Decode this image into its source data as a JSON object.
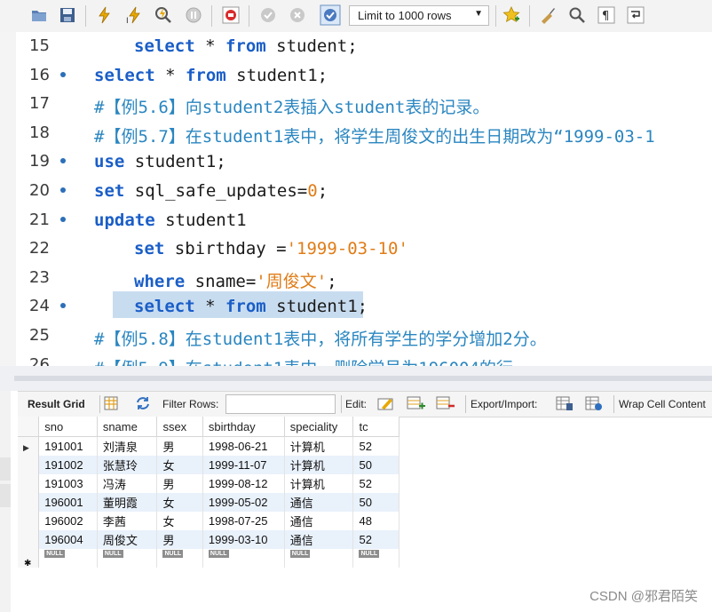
{
  "toolbar": {
    "limit_label": "Limit to 1000 rows",
    "icons": [
      "open-folder-icon",
      "save-icon",
      "execute-icon",
      "execute-current-icon",
      "explain-icon",
      "stop-icon",
      "toggle-error-icon",
      "commit-icon",
      "rollback-icon",
      "autocommit-icon",
      "beautify-icon",
      "find-icon",
      "invisible-chars-icon",
      "wrap-icon"
    ]
  },
  "editor": {
    "lines": [
      {
        "num": "15",
        "dot": false,
        "indent": "    ",
        "tokens": [
          [
            "kw",
            "select"
          ],
          [
            "tx",
            " * "
          ],
          [
            "kw",
            "from"
          ],
          [
            "tx",
            " student;"
          ]
        ]
      },
      {
        "num": "16",
        "dot": true,
        "indent": "",
        "tokens": [
          [
            "kw",
            "select"
          ],
          [
            "tx",
            " * "
          ],
          [
            "kw",
            "from"
          ],
          [
            "tx",
            " student1;"
          ]
        ]
      },
      {
        "num": "17",
        "dot": false,
        "indent": "",
        "tokens": [
          [
            "cm",
            "#【例5.6】向student2表插入student表的记录。"
          ]
        ]
      },
      {
        "num": "18",
        "dot": false,
        "indent": "",
        "tokens": [
          [
            "cm",
            "#【例5.7】在student1表中，将学生周俊文的出生日期改为“1999-03-1"
          ]
        ]
      },
      {
        "num": "19",
        "dot": true,
        "indent": "",
        "tokens": [
          [
            "kw",
            "use"
          ],
          [
            "tx",
            " student1;"
          ]
        ]
      },
      {
        "num": "20",
        "dot": true,
        "indent": "",
        "tokens": [
          [
            "kw",
            "set"
          ],
          [
            "tx",
            " sql_safe_updates="
          ],
          [
            "nm",
            "0"
          ],
          [
            "tx",
            ";"
          ]
        ]
      },
      {
        "num": "21",
        "dot": true,
        "indent": "",
        "tokens": [
          [
            "kw",
            "update"
          ],
          [
            "tx",
            " student1"
          ]
        ]
      },
      {
        "num": "22",
        "dot": false,
        "indent": "    ",
        "tokens": [
          [
            "kw",
            "set"
          ],
          [
            "tx",
            " sbirthday ="
          ],
          [
            "st",
            "'1999-03-10'"
          ]
        ]
      },
      {
        "num": "23",
        "dot": false,
        "indent": "    ",
        "tokens": [
          [
            "kw",
            "where"
          ],
          [
            "tx",
            " sname="
          ],
          [
            "st",
            "'周俊文'"
          ],
          [
            "tx",
            ";"
          ]
        ]
      },
      {
        "num": "24",
        "dot": true,
        "indent": "    ",
        "tokens": [
          [
            "kw",
            "select"
          ],
          [
            "tx",
            " * "
          ],
          [
            "kw",
            "from"
          ],
          [
            "tx",
            " student1;"
          ]
        ]
      },
      {
        "num": "25",
        "dot": false,
        "indent": "",
        "tokens": [
          [
            "cm",
            "#【例5.8】在student1表中，将所有学生的学分增加2分。"
          ]
        ]
      },
      {
        "num": "26",
        "dot": false,
        "indent": "",
        "tokens": [
          [
            "cm",
            "#【例5.9】在student1表中，删除学号为196004的行"
          ]
        ]
      }
    ]
  },
  "result_bar": {
    "result_grid": "Result Grid",
    "filter_rows": "Filter Rows:",
    "edit": "Edit:",
    "export_import": "Export/Import:",
    "wrap": "Wrap Cell Content"
  },
  "grid": {
    "columns": [
      "sno",
      "sname",
      "ssex",
      "sbirthday",
      "speciality",
      "tc"
    ],
    "rows": [
      [
        "191001",
        "刘清泉",
        "男",
        "1998-06-21",
        "计算机",
        "52"
      ],
      [
        "191002",
        "张慧玲",
        "女",
        "1999-11-07",
        "计算机",
        "50"
      ],
      [
        "191003",
        "冯涛",
        "男",
        "1999-08-12",
        "计算机",
        "52"
      ],
      [
        "196001",
        "董明霞",
        "女",
        "1999-05-02",
        "通信",
        "50"
      ],
      [
        "196002",
        "李茜",
        "女",
        "1998-07-25",
        "通信",
        "48"
      ],
      [
        "196004",
        "周俊文",
        "男",
        "1999-03-10",
        "通信",
        "52"
      ]
    ],
    "null_label": "NULL"
  },
  "watermark": "CSDN @邪君陌笑"
}
